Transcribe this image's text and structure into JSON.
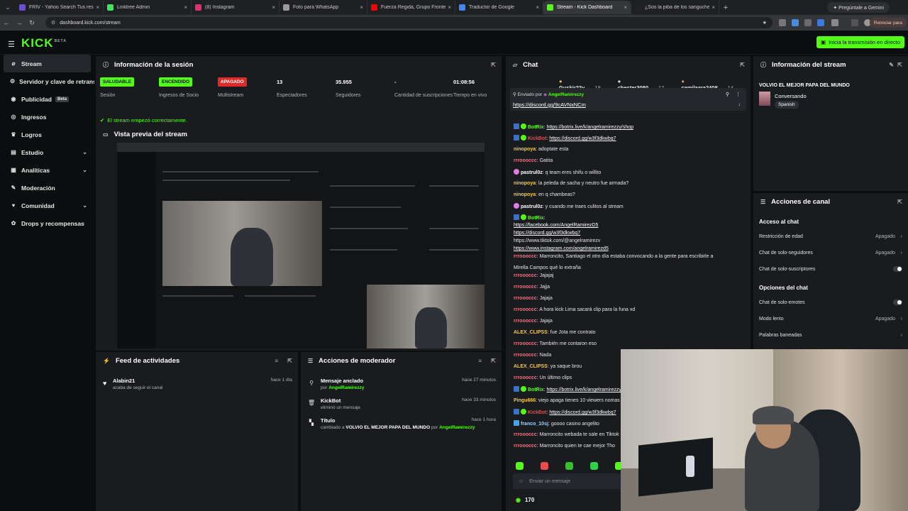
{
  "browser": {
    "tabs": [
      {
        "title": "FRIV - Yahoo Search Tus resultados",
        "color": "#6f4bd8"
      },
      {
        "title": "Linktree Admin",
        "color": "#43e55e"
      },
      {
        "title": "(8) Instagram",
        "color": "#e1306c"
      },
      {
        "title": "Foto para WhatsApp",
        "color": "#9a9a9a"
      },
      {
        "title": "Fuerza Regida, Grupo Frontera",
        "color": "#ff0000"
      },
      {
        "title": "Traductor de Google",
        "color": "#4285f4"
      },
      {
        "title": "Stream - Kick Dashboard",
        "color": "#53fc18"
      },
      {
        "title": "¿Sos la piba de los sanguches",
        "color": "#222222"
      }
    ],
    "gemini": "✦ Pregúntale a Gemini",
    "url": "dashboard.kick.com/stream",
    "restart": "Reiniciar para"
  },
  "header": {
    "logo": "KICK",
    "logo_beta": "BETA",
    "live_button": "Inicia la transmisión en directo"
  },
  "sidebar": [
    {
      "label": "Stream",
      "icon": "⌀",
      "active": true
    },
    {
      "label": "Servidor y clave de retransmisión",
      "icon": "⚙"
    },
    {
      "label": "Publicidad",
      "icon": "◉",
      "beta": "Beta"
    },
    {
      "label": "Ingresos",
      "icon": "◎"
    },
    {
      "label": "Logros",
      "icon": "♛"
    },
    {
      "label": "Estudio",
      "icon": "▤",
      "chev": "⌄"
    },
    {
      "label": "Analíticas",
      "icon": "▦",
      "chev": "⌄"
    },
    {
      "label": "Moderación",
      "icon": "✎"
    },
    {
      "label": "Comunidad",
      "icon": "♥",
      "chev": "⌄"
    },
    {
      "label": "Drops y recompensas",
      "icon": "✿"
    }
  ],
  "session": {
    "title": "Información de la sesión",
    "stats": [
      {
        "badge": "SALUDABLE",
        "badge_type": "g",
        "label": "Sesión"
      },
      {
        "badge": "ENCENDIDO",
        "badge_type": "g",
        "label": "Ingresos de Socio"
      },
      {
        "badge": "APAGADO",
        "badge_type": "r",
        "label": "Multistream"
      },
      {
        "value": "13",
        "label": "Espectadores"
      },
      {
        "value": "35.955",
        "label": "Seguidores"
      },
      {
        "value": "-",
        "label": "Cantidad de suscripciones"
      },
      {
        "value": "01:08:56",
        "label": "Tiempo en vivo"
      }
    ],
    "ok_message": "El stream empezó correctamente."
  },
  "preview": {
    "title": "Vista previa del stream"
  },
  "activity": {
    "title": "Feed de actividades",
    "items": [
      {
        "name": "Alabin21",
        "sub": "acaba de seguir el canal",
        "time": "hace 1 día"
      }
    ]
  },
  "modactions": {
    "title": "Acciones de moderador",
    "items": [
      {
        "icon": "⚲",
        "title": "Mensaje anclado",
        "pre": "por",
        "user": "AngelRamirezzy",
        "time": "hace 27 minutos"
      },
      {
        "icon": "🗑",
        "title": "KickBot",
        "pre": "eliminó un mensaje",
        "time": "hace 33 minutos"
      },
      {
        "icon": "▚",
        "title": "Título",
        "pre": "cambiado a",
        "bold": "VOLVIO EL MEJOR PAPA DEL MUNDO",
        "post": "por",
        "user": "AngelRamirezzy",
        "time": "hace 1 hora"
      }
    ]
  },
  "chat": {
    "title": "Chat",
    "top_chatters": [
      {
        "name": "Guskir22v",
        "count": "18",
        "color": "#f2c94c"
      },
      {
        "name": "chester3080",
        "count": "17",
        "color": "#e0e0e0"
      },
      {
        "name": "camilaara2408",
        "count": "14",
        "color": "#e39b5a"
      }
    ],
    "pinned": {
      "sent_by": "Enviado por",
      "user": "AngelRamirezzy",
      "link": "https://discord.gg/9cAVNxNCm"
    },
    "messages": [
      {
        "user": "BotRix",
        "color": "#53fc18",
        "badges": true,
        "text": "https://botrix.live/k/angelramirezzy/shop",
        "link": true
      },
      {
        "user": "KickBot",
        "color": "#e84d4d",
        "badges": true,
        "text": "https://discord.gg/w3f3dkwbq7",
        "link": true
      },
      {
        "user": "ninopoya",
        "color": "#f2c94c",
        "text": "adoptate esta"
      },
      {
        "user": "rrroooccc",
        "color": "#ff6b7d",
        "text": "Gatita"
      },
      {
        "user": "pastrul0z",
        "color": "#ffffff",
        "pink": true,
        "text": "q team eres shifu o willito"
      },
      {
        "user": "ninopoya",
        "color": "#f2c94c",
        "text": "la peleda de sacha y neutro fue armada?"
      },
      {
        "user": "ninopoya",
        "color": "#f2c94c",
        "text": "en q chambeas?"
      },
      {
        "user": "pastrul0z",
        "color": "#ffffff",
        "pink": true,
        "text": "y cuando me traes culitos al stream"
      },
      {
        "user": "BotRix",
        "color": "#53fc18",
        "badges": true,
        "text": ""
      },
      {
        "user": "",
        "text": "https://facebook.com/AngelRamirezD5",
        "link": true
      },
      {
        "user": "",
        "text": "https://discord.gg/w3f3dkwbq7",
        "link": true
      },
      {
        "user": "",
        "text": "https://www.tiktok.com/@angelramirezv",
        "plain": true
      },
      {
        "user": "",
        "text": "https://www.instagram.com/angelramirezd5",
        "link": true
      },
      {
        "user": "rrroooccc",
        "color": "#ff6b7d",
        "text": "Marroncito, Santiago el otro día estaba convocando a la gente para escribirle a"
      },
      {
        "user": "",
        "text": "Mirella Campos qué lo extraña",
        "plain": true
      },
      {
        "user": "rrroooccc",
        "color": "#ff6b7d",
        "text": "Jajajaj"
      },
      {
        "user": "rrroooccc",
        "color": "#ff6b7d",
        "text": "Jajja"
      },
      {
        "user": "rrroooccc",
        "color": "#ff6b7d",
        "text": "Jajaja"
      },
      {
        "user": "rrroooccc",
        "color": "#ff6b7d",
        "text": "A hora kick Lima sacará clip para la funa xd"
      },
      {
        "user": "rrroooccc",
        "color": "#ff6b7d",
        "text": "Jajaja"
      },
      {
        "user": "ALEX_CLIPSS",
        "color": "#f2c94c",
        "text": "fue Jota me contrato"
      },
      {
        "user": "rrroooccc",
        "color": "#ff6b7d",
        "text": "También me contaron eso"
      },
      {
        "user": "rrroooccc",
        "color": "#ff6b7d",
        "text": "Nada"
      },
      {
        "user": "ALEX_CLIPSS",
        "color": "#f2c94c",
        "text": "ya saque brou"
      },
      {
        "user": "rrroooccc",
        "color": "#ff6b7d",
        "text": "Un último clips"
      },
      {
        "user": "BotRix",
        "color": "#53fc18",
        "badges": true,
        "text": "https://botrix.live/k/angelramirezzy/shop",
        "link": true
      },
      {
        "user": "Pingu666",
        "color": "#f2c94c",
        "text": "viejo apaga tienes 10 viewers nomas"
      },
      {
        "user": "KickBot",
        "color": "#e84d4d",
        "badges": true,
        "text": "https://discord.gg/w3f3dkwbq7",
        "link": true
      },
      {
        "user": "franco_10sj",
        "color": "#9ad1ff",
        "blue": true,
        "text": "goooo casino angelito"
      },
      {
        "user": "rrroooccc",
        "color": "#ff6b7d",
        "text": "Marroncito webada te sale en Tiktok"
      },
      {
        "user": "rrroooccc",
        "color": "#ff6b7d",
        "text": "Marroncito quien te cae mejor Tho"
      }
    ],
    "input_placeholder": "Enviar un mensaje",
    "viewers": "170"
  },
  "stream_info": {
    "title": "Información del stream",
    "stream_title": "VOLVIO EL MEJOR PAPA DEL MUNDO",
    "category": "Conversando",
    "language": "Spanish"
  },
  "actions": {
    "title": "Acciones de canal",
    "access_title": "Acceso al chat",
    "access": [
      {
        "label": "Restricción de edad",
        "value": "Apagado"
      },
      {
        "label": "Chat de solo-seguidores",
        "value": "Apagado"
      },
      {
        "label": "Chat de solo-suscriptores",
        "toggle": true
      }
    ],
    "options_title": "Opciones del chat",
    "options": [
      {
        "label": "Chat de solo-emotes",
        "toggle": true
      },
      {
        "label": "Modo lento",
        "value": "Apagado"
      },
      {
        "label": "Palabras baneadas"
      }
    ]
  }
}
